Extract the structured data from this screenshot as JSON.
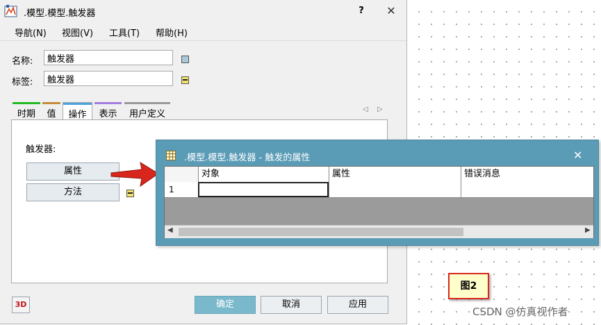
{
  "window": {
    "title": ".模型.模型.触发器",
    "help_label": "?",
    "close_label": "✕"
  },
  "menu": {
    "items": [
      {
        "label": "导航(N)"
      },
      {
        "label": "视图(V)"
      },
      {
        "label": "工具(T)"
      },
      {
        "label": "帮助(H)"
      }
    ]
  },
  "fields": {
    "name_label": "名称:",
    "name_value": "触发器",
    "tag_label": "标签:",
    "tag_value": "触发器"
  },
  "tabs": [
    {
      "label": "时期",
      "color": "#22bb22"
    },
    {
      "label": "值",
      "color": "#c58a3a"
    },
    {
      "label": "操作",
      "color": "#4aa3df",
      "active": true
    },
    {
      "label": "表示",
      "color": "#a47de0"
    },
    {
      "label": "用户定义",
      "color": "#9a9a9a"
    }
  ],
  "tab_scroll": {
    "left": "◁",
    "right": "▷"
  },
  "operations": {
    "label": "触发器:",
    "properties_button": "属性",
    "methods_button": "方法"
  },
  "footer": {
    "three_d_label": "3D",
    "ok_button": "确定",
    "cancel_button": "取消",
    "apply_button": "应用"
  },
  "dialog": {
    "title": ".模型.模型.触发器 - 触发的属性",
    "close_label": "✕",
    "columns": [
      "对象",
      "属性",
      "错误消息"
    ],
    "rows": [
      {
        "index": "1",
        "object": "",
        "property": "",
        "error": ""
      }
    ],
    "scroll_left": "◀",
    "scroll_right": "▶"
  },
  "figure_label": "图2",
  "watermark": "CSDN @仿真视作者",
  "colors": {
    "dialog_frame": "#5a9bb6",
    "ok_button": "#7ab8cc",
    "arrow": "#d9261c",
    "figure_border": "#d9261c",
    "figure_fill": "#ffffcc"
  }
}
